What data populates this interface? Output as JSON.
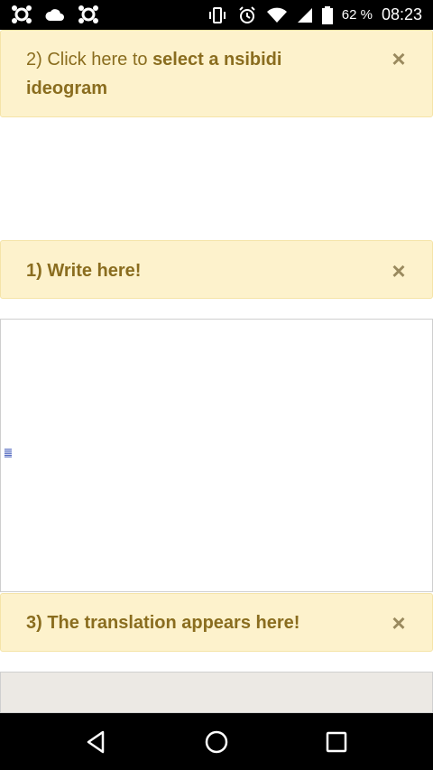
{
  "status_bar": {
    "battery_percent": "62 %",
    "time": "08:23",
    "icons": [
      "app-icon-1",
      "cloud-icon",
      "app-icon-2",
      "vibrate-icon",
      "alarm-icon",
      "wifi-icon",
      "signal-icon",
      "battery-icon"
    ]
  },
  "notes": {
    "select": {
      "prefix": "2) Click here to ",
      "bold": "select a nsibidi ideogram",
      "close": "×"
    },
    "write": {
      "text": "1) Write here!",
      "close": "×"
    },
    "translation": {
      "text": "3) The translation appears here!",
      "close": "×"
    }
  },
  "canvas": {
    "glyph": "䷀"
  },
  "colors": {
    "note_bg": "#fdf2cc",
    "note_text": "#8a6d1f",
    "close": "#9a8a5e",
    "panel": "#ece9e4"
  },
  "nav": {
    "icons": [
      "back-icon",
      "home-icon",
      "recent-apps-icon"
    ]
  }
}
